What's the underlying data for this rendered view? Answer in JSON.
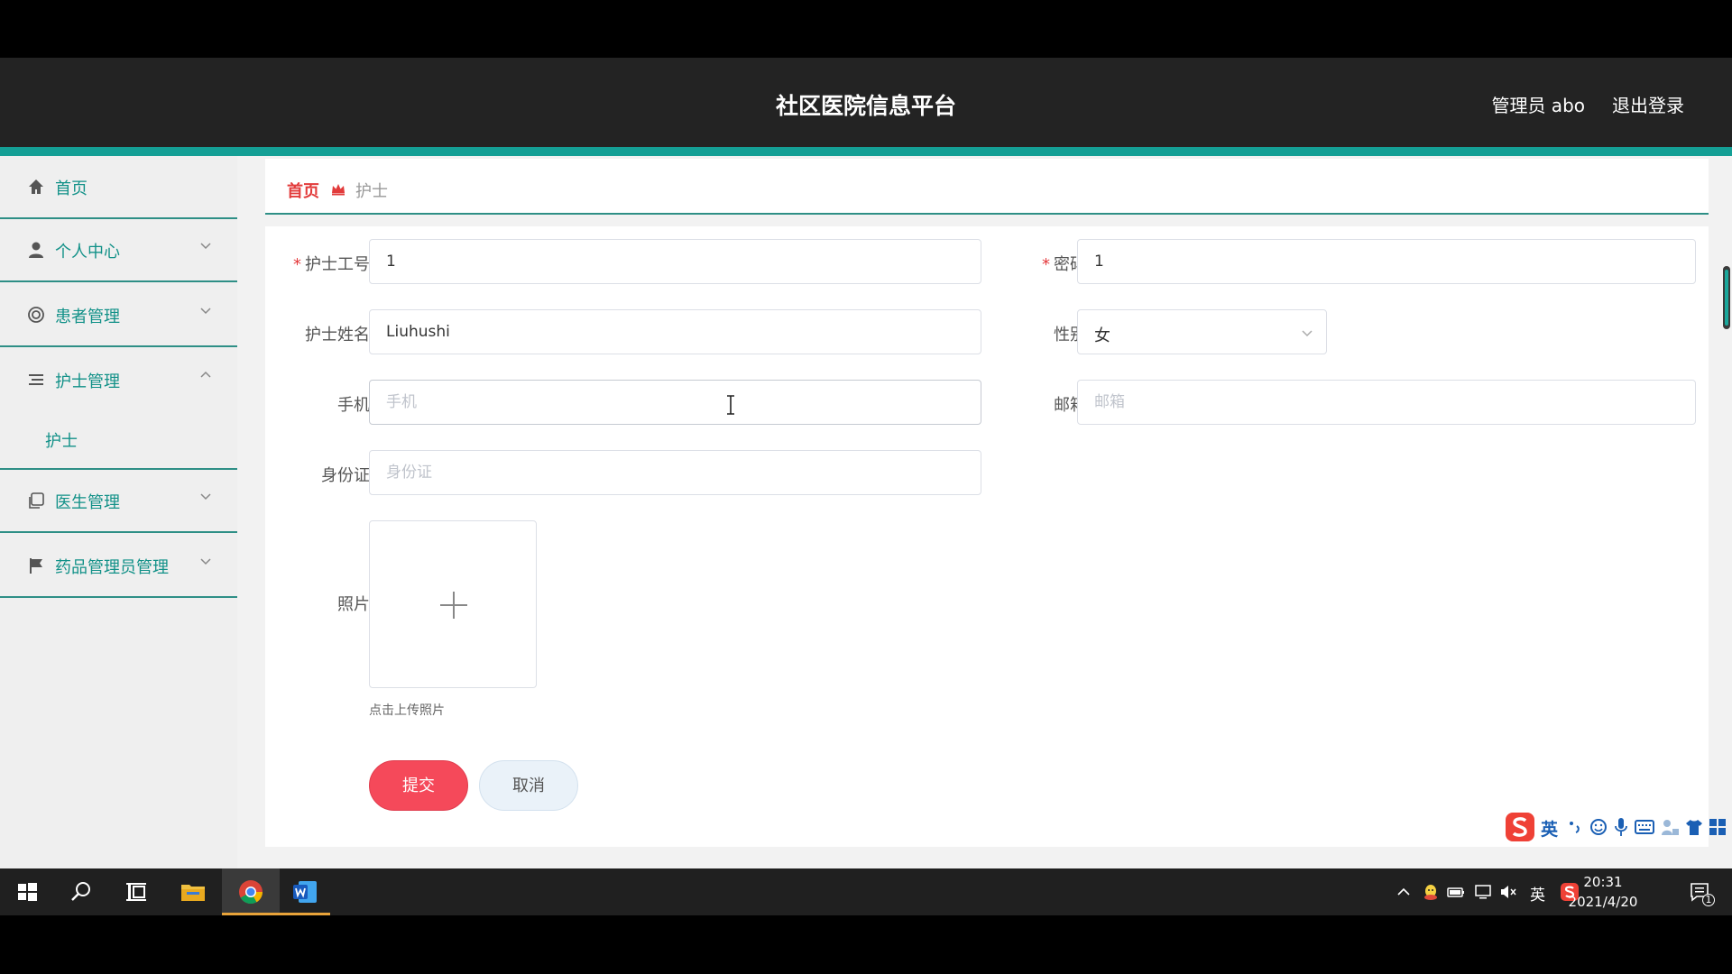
{
  "header": {
    "title": "社区医院信息平台",
    "admin": "管理员 abo",
    "logout": "退出登录"
  },
  "sidebar": {
    "items": [
      {
        "label": "首页",
        "icon": "home-icon"
      },
      {
        "label": "个人中心",
        "icon": "user-icon",
        "expandable": true
      },
      {
        "label": "患者管理",
        "icon": "patients-icon",
        "expandable": true
      },
      {
        "label": "护士管理",
        "icon": "list-icon",
        "expanded": true
      },
      {
        "label": "医生管理",
        "icon": "copy-icon",
        "expandable": true
      },
      {
        "label": "药品管理员管理",
        "icon": "flag-icon",
        "expandable": true
      }
    ],
    "subitems": [
      {
        "label": "护士"
      }
    ]
  },
  "breadcrumb": {
    "home": "首页",
    "current": "护士"
  },
  "form": {
    "nurse_id": {
      "label": "护士工号",
      "value": "1"
    },
    "password": {
      "label": "密码",
      "value": "1"
    },
    "nurse_name": {
      "label": "护士姓名",
      "value": "Liuhushi"
    },
    "gender": {
      "label": "性别",
      "value": "女"
    },
    "phone": {
      "label": "手机",
      "placeholder": "手机"
    },
    "email": {
      "label": "邮箱",
      "placeholder": "邮箱"
    },
    "id_card": {
      "label": "身份证",
      "placeholder": "身份证"
    },
    "photo": {
      "label": "照片",
      "tip": "点击上传照片"
    },
    "submit": "提交",
    "cancel": "取消"
  },
  "ime": {
    "mode": "英"
  },
  "taskbar": {
    "tray_lang": "英",
    "time": "20:31",
    "date": "2021/4/20",
    "notification_count": "1"
  },
  "colors": {
    "accent": "#149f95",
    "header_bg": "#232323",
    "submit": "#f5495a",
    "breadcrumb_home": "#e23b3b"
  }
}
